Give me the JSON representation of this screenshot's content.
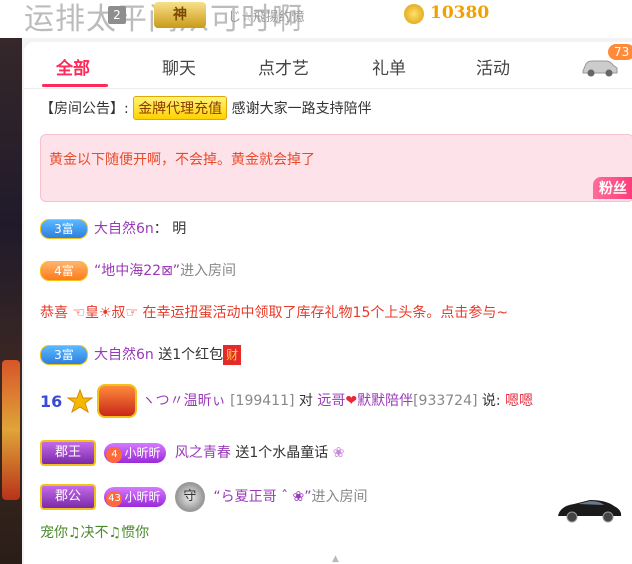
{
  "header": {
    "banner_text": "运排太平间从可时啊",
    "seat_number": "2",
    "god_badge": "神",
    "top_user_name": "じ☆飛揚约憶",
    "coin_count": "10380"
  },
  "tabs": [
    {
      "label": "全部",
      "active": true
    },
    {
      "label": "聊天",
      "active": false
    },
    {
      "label": "点才艺",
      "active": false
    },
    {
      "label": "礼单",
      "active": false
    },
    {
      "label": "活动",
      "active": false
    }
  ],
  "car_count": "73",
  "announcement": {
    "prefix": "【房间公告】:",
    "tag": "金牌代理充值",
    "text": "感谢大家一路支持陪伴"
  },
  "pinned_message": {
    "text": "黄金以下随便开啊，不会掉。黄金就会掉了",
    "fan_tag": "粉丝"
  },
  "chat": {
    "r1": {
      "badge": "3富",
      "name": "大自然6n",
      "text": "：  明"
    },
    "r2": {
      "badge": "4富",
      "name": "“地中海22⊠”",
      "text": "进入房间"
    },
    "r3": {
      "text": "恭喜 ☜皇☀叔☞ 在幸运扭蛋活动中领取了库存礼物15个上头条。点击参与~"
    },
    "r4": {
      "badge": "3富",
      "name": "大自然6n",
      "text": "送1个红包",
      "gift": "财"
    },
    "r5": {
      "level": "16",
      "name": "ヽつ〃温昕ぃ",
      "id": "[199411]",
      "to": "对",
      "target": "远哥",
      "target2": "默默陪伴",
      "target_id": "[933724]",
      "said": "说:",
      "text": "嗯嗯"
    },
    "r6": {
      "royal": "郡王",
      "fan_num": "4",
      "fan_name": "小昕昕",
      "name": "风之青春",
      "text": "送1个水晶童话"
    },
    "r7": {
      "royal": "郡公",
      "fan_num": "43",
      "fan_name": "小昕昕",
      "guard": "守",
      "name": "“ら夏正哥 ˆ ❀”",
      "text": "进入房间"
    },
    "r8": {
      "text": "宠你♫决不♫惯你"
    }
  },
  "colors": {
    "accent": "#ff2a5a",
    "gold": "#f0a000",
    "purple": "#9a3ab8"
  }
}
